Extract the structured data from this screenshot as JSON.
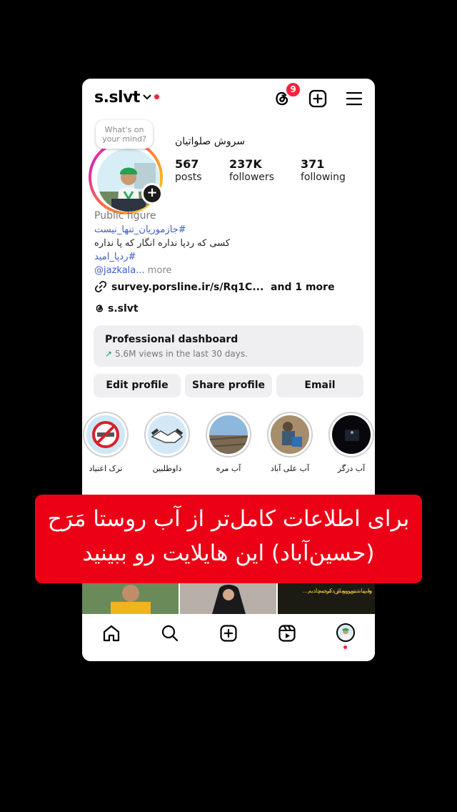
{
  "profile": {
    "username": "s.slvt",
    "threads_badge": "9",
    "bubble": "What's on your mind?",
    "display_name": "سروش صلواتیان",
    "stats": [
      {
        "value": "567",
        "label": "posts"
      },
      {
        "value": "237K",
        "label": "followers"
      },
      {
        "value": "371",
        "label": "following"
      }
    ],
    "category": "Public figure",
    "bio_tag1": "#جازموریان_تنها_نیست",
    "bio_text": "کسی که ردپا نداره انگار که پا نداره",
    "bio_tag2": "#ردپا_امید",
    "bio_mention": "@jazkala...",
    "bio_more": " more",
    "link": "survey.porsline.ir/s/Rq1C...",
    "link_more": "and 1 more",
    "threads_handle": "s.slvt"
  },
  "dashboard": {
    "title": "Professional dashboard",
    "subtitle": "5.6M views in the last 30 days."
  },
  "buttons": {
    "edit": "Edit profile",
    "share": "Share profile",
    "email": "Email"
  },
  "highlights": [
    {
      "label": "ترک اعتیاد"
    },
    {
      "label": "داوطلبین"
    },
    {
      "label": "آب مره"
    },
    {
      "label": "آب علی آباد"
    },
    {
      "label": "آب درگز"
    }
  ],
  "grid_texts": {
    "line1": "به ماشین رو از دست دادیم...",
    "line2": "ولی... تموممش کردیم..."
  },
  "overlay": {
    "line1": "برای اطلاعات کامل‌تر از آب روستا مَرَح",
    "line2": "(حسین‌آباد) این هایلایت رو ببینید"
  },
  "colors": {
    "accent_red": "#ec0016",
    "link_blue": "#3b5ec9"
  }
}
